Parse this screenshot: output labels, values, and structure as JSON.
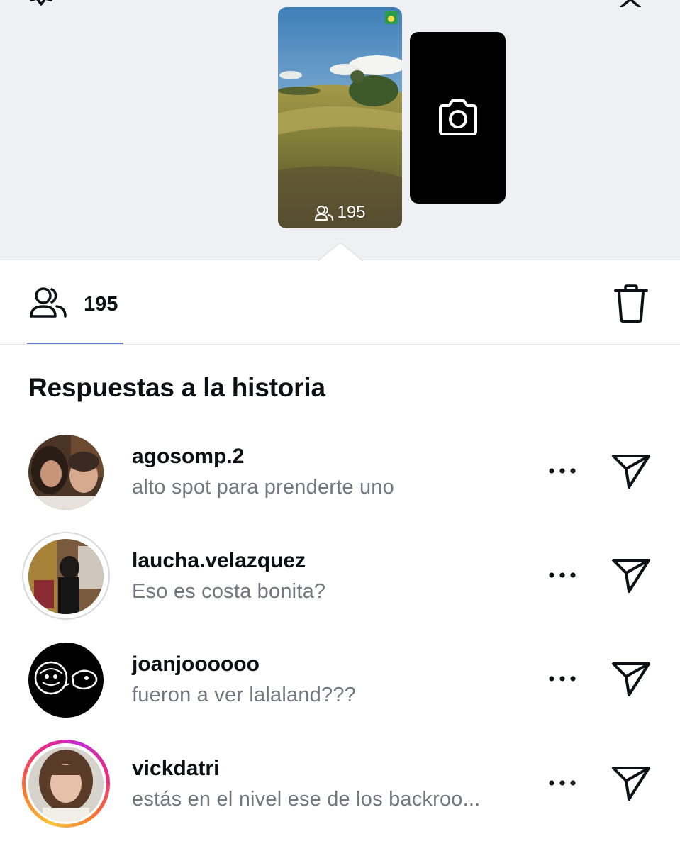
{
  "header": {
    "settings_icon": "gear-icon",
    "close_icon": "close-icon"
  },
  "story_tray": {
    "thumbnail_views": "195",
    "new_story_icon": "camera-icon"
  },
  "stats": {
    "viewers_count": "195",
    "viewers_icon": "people-icon",
    "delete_icon": "trash-icon"
  },
  "replies_section": {
    "title": "Respuestas a la historia",
    "items": [
      {
        "username": "agosomp.2",
        "text": "alto spot para prenderte uno",
        "ring": "none"
      },
      {
        "username": "laucha.velazquez",
        "text": "Eso es costa bonita?",
        "ring": "seen"
      },
      {
        "username": "joanjoooooo",
        "text": "fueron a ver lalaland???",
        "ring": "none"
      },
      {
        "username": "vickdatri",
        "text": "estás en el nivel ese de los backroo...",
        "ring": "unseen-story"
      }
    ]
  },
  "colors": {
    "tray_bg": "#eef0f3",
    "tab_underline": "#6b7fd7",
    "secondary_text": "#737780"
  }
}
